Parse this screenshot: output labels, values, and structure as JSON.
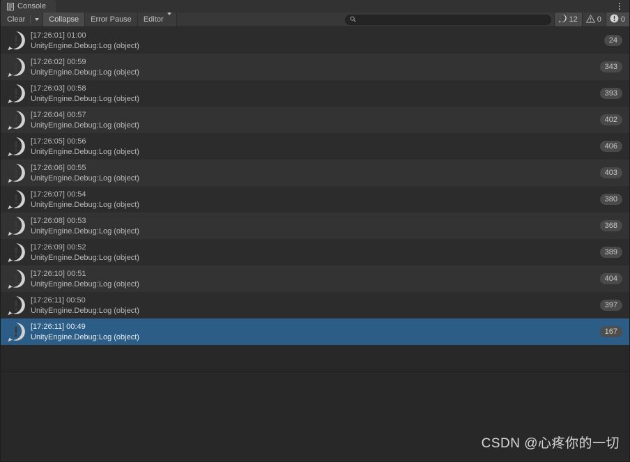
{
  "window": {
    "tab_label": "Console",
    "tab_icon": "console-icon",
    "menu_icon": "kebab-menu-icon"
  },
  "toolbar": {
    "clear_label": "Clear",
    "clear_dropdown_icon": "chevron-down-icon",
    "collapse_label": "Collapse",
    "error_pause_label": "Error Pause",
    "editor_label": "Editor",
    "editor_dropdown_icon": "chevron-down-icon",
    "search": {
      "icon": "search-icon",
      "value": "",
      "placeholder": ""
    },
    "counters": [
      {
        "name": "log-count",
        "icon": "log-icon",
        "value": "12",
        "active": true
      },
      {
        "name": "warning-count",
        "icon": "warning-icon",
        "value": "0",
        "active": false
      },
      {
        "name": "error-count",
        "icon": "error-icon",
        "value": "0",
        "active": true
      }
    ]
  },
  "console": {
    "entries": [
      {
        "timestamp": "[17:26:01] 01:00",
        "stack": "UnityEngine.Debug:Log (object)",
        "count": "24",
        "icon": "log-icon",
        "selected": false
      },
      {
        "timestamp": "[17:26:02] 00:59",
        "stack": "UnityEngine.Debug:Log (object)",
        "count": "343",
        "icon": "log-icon",
        "selected": false
      },
      {
        "timestamp": "[17:26:03] 00:58",
        "stack": "UnityEngine.Debug:Log (object)",
        "count": "393",
        "icon": "log-icon",
        "selected": false
      },
      {
        "timestamp": "[17:26:04] 00:57",
        "stack": "UnityEngine.Debug:Log (object)",
        "count": "402",
        "icon": "log-icon",
        "selected": false
      },
      {
        "timestamp": "[17:26:05] 00:56",
        "stack": "UnityEngine.Debug:Log (object)",
        "count": "406",
        "icon": "log-icon",
        "selected": false
      },
      {
        "timestamp": "[17:26:06] 00:55",
        "stack": "UnityEngine.Debug:Log (object)",
        "count": "403",
        "icon": "log-icon",
        "selected": false
      },
      {
        "timestamp": "[17:26:07] 00:54",
        "stack": "UnityEngine.Debug:Log (object)",
        "count": "380",
        "icon": "log-icon",
        "selected": false
      },
      {
        "timestamp": "[17:26:08] 00:53",
        "stack": "UnityEngine.Debug:Log (object)",
        "count": "368",
        "icon": "log-icon",
        "selected": false
      },
      {
        "timestamp": "[17:26:09] 00:52",
        "stack": "UnityEngine.Debug:Log (object)",
        "count": "389",
        "icon": "log-icon",
        "selected": false
      },
      {
        "timestamp": "[17:26:10] 00:51",
        "stack": "UnityEngine.Debug:Log (object)",
        "count": "404",
        "icon": "log-icon",
        "selected": false
      },
      {
        "timestamp": "[17:26:11] 00:50",
        "stack": "UnityEngine.Debug:Log (object)",
        "count": "397",
        "icon": "log-icon",
        "selected": false
      },
      {
        "timestamp": "[17:26:11] 00:49",
        "stack": "UnityEngine.Debug:Log (object)",
        "count": "167",
        "icon": "log-icon",
        "selected": true
      }
    ]
  },
  "detail": {
    "text": ""
  },
  "watermark": {
    "text": "CSDN @心疼你的一切"
  },
  "colors": {
    "selection": "#2c5d87",
    "row_even": "#2c2c2c",
    "row_odd": "#333333",
    "toolbar": "#383838",
    "background": "#282828"
  }
}
